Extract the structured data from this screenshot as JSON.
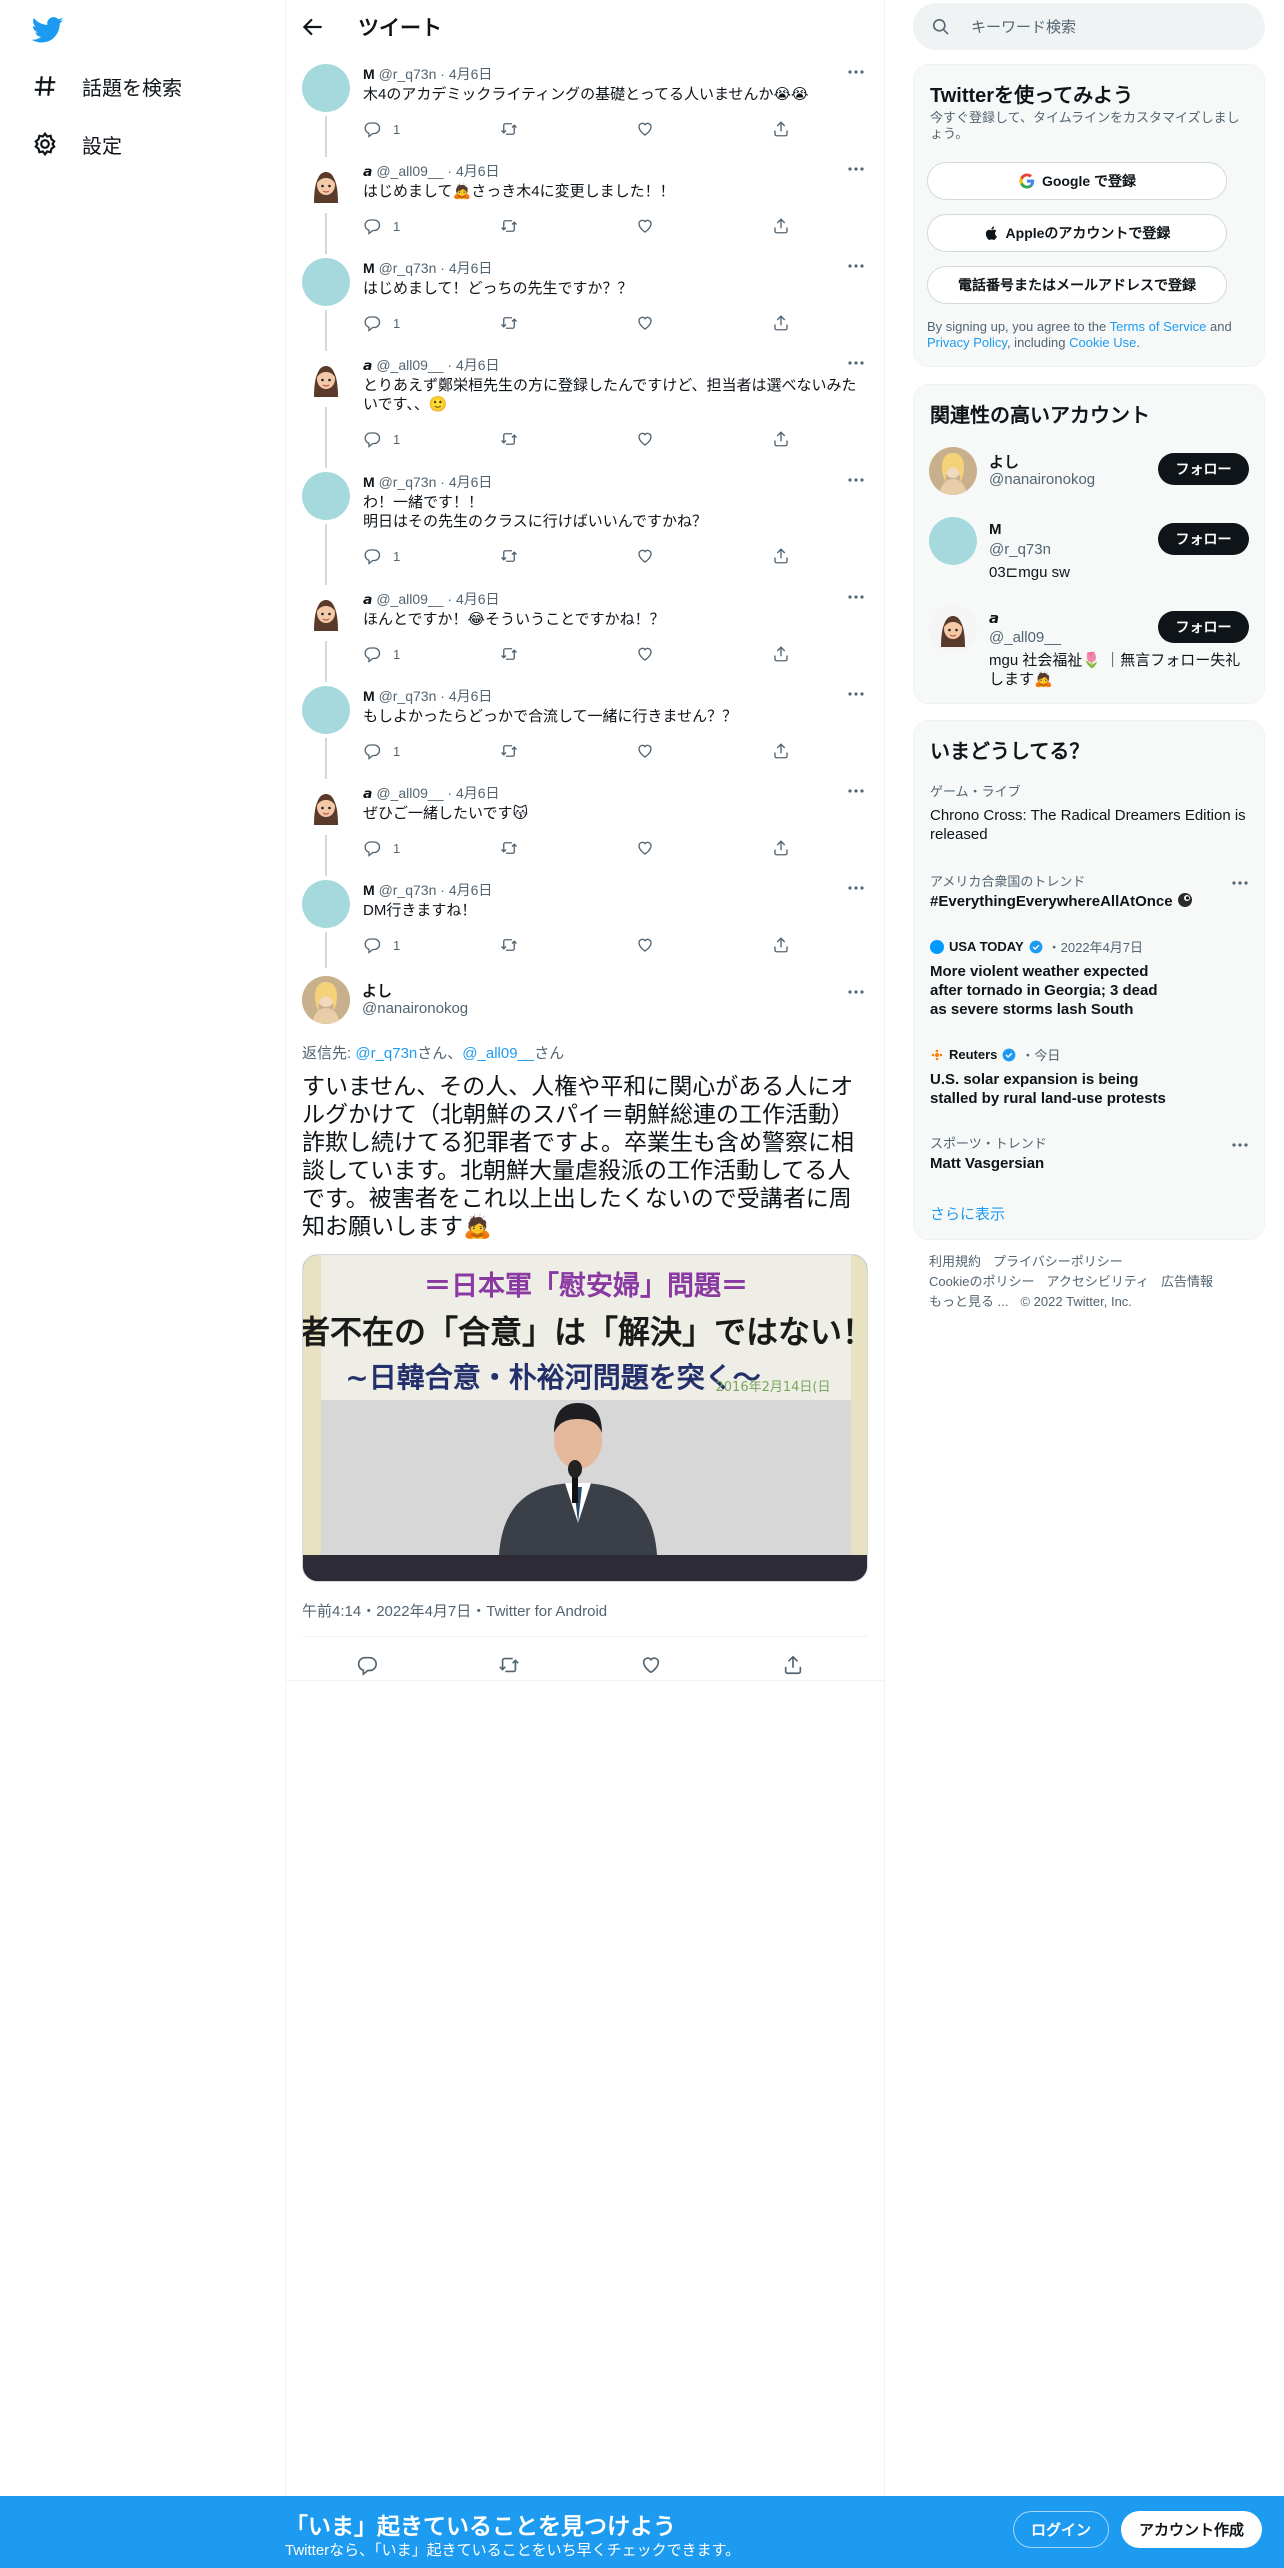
{
  "nav": {
    "search_topics": "話題を検索",
    "settings": "設定"
  },
  "header": {
    "title": "ツイート"
  },
  "replies": [
    {
      "author": "M",
      "handle": "@r_q73n",
      "date": "4月6日",
      "text": "木4のアカデミックライティングの基礎とってる人いませんか😭😭",
      "replies": "1",
      "avatar": "M"
    },
    {
      "author": "𝙖",
      "handle": "@_all09__",
      "date": "4月6日",
      "text": "はじめまして🙇さっき木4に変更しました！！",
      "replies": "1",
      "avatar": "a"
    },
    {
      "author": "M",
      "handle": "@r_q73n",
      "date": "4月6日",
      "text": "はじめまして！どっちの先生ですか？？",
      "replies": "1",
      "avatar": "M"
    },
    {
      "author": "𝙖",
      "handle": "@_all09__",
      "date": "4月6日",
      "text": "とりあえず鄭栄桓先生の方に登録したんですけど、担当者は選べないみたいです、、🙂",
      "replies": "1",
      "avatar": "a"
    },
    {
      "author": "M",
      "handle": "@r_q73n",
      "date": "4月6日",
      "text": "わ！一緒です！！\n明日はその先生のクラスに行けばいいんですかね？",
      "replies": "1",
      "avatar": "M"
    },
    {
      "author": "𝙖",
      "handle": "@_all09__",
      "date": "4月6日",
      "text": "ほんとですか！😂そういうことですかね！？",
      "replies": "1",
      "avatar": "a"
    },
    {
      "author": "M",
      "handle": "@r_q73n",
      "date": "4月6日",
      "text": "もしよかったらどっかで合流して一緒に行きません？？",
      "replies": "1",
      "avatar": "M"
    },
    {
      "author": "𝙖",
      "handle": "@_all09__",
      "date": "4月6日",
      "text": "ぜひご一緒したいです😽",
      "replies": "1",
      "avatar": "a"
    },
    {
      "author": "M",
      "handle": "@r_q73n",
      "date": "4月6日",
      "text": "DM行きますね！",
      "replies": "1",
      "avatar": "M"
    }
  ],
  "main_tweet": {
    "author": "よし",
    "handle": "@nanaironokog",
    "reply_prefix": "返信先: ",
    "reply_to_1": "@r_q73n",
    "reply_mid": "さん、",
    "reply_to_2": "@_all09__",
    "reply_suffix": "さん",
    "text": "すいません、その人、人権や平和に関心がある人にオルグかけて（北朝鮮のスパイ＝朝鮮総連の工作活動）詐欺し続けてる犯罪者ですよ。卒業生も含め警察に相談しています。北朝鮮大量虐殺派の工作活動してる人です。被害者をこれ以上出したくないので受講者に周知お願いします🙇",
    "media_banner_line1": "＝日本軍「慰安婦」問題＝",
    "media_banner_line2": "者不在の「合意」は「解決」ではない！",
    "media_banner_line3": "~日韓合意・朴裕河問題を突く～",
    "media_banner_date": "2016年2月14日(日",
    "meta": "午前4:14・2022年4月7日・Twitter for Android"
  },
  "search": {
    "placeholder": "キーワード検索"
  },
  "signup": {
    "title": "Twitterを使ってみよう",
    "subtitle": "今すぐ登録して、タイムラインをカスタマイズしましょう。",
    "google": "Google で登録",
    "apple": "Appleのアカウントで登録",
    "phone": "電話番号またはメールアドレスで登録",
    "legal_1": "By signing up, you agree to the ",
    "legal_tos": "Terms of Service",
    "legal_2": " and ",
    "legal_pp": "Privacy Policy",
    "legal_3": ", including ",
    "legal_cookie": "Cookie Use",
    "legal_4": "."
  },
  "relevant": {
    "title": "関連性の高いアカウント",
    "follow_label": "フォロー",
    "accounts": [
      {
        "name": "よし",
        "handle": "@nanaironokog",
        "bio": ""
      },
      {
        "name": "M",
        "handle": "@r_q73n",
        "bio": "03⊏mgu sw"
      },
      {
        "name": "𝙖",
        "handle": "@_all09__",
        "bio": "mgu 社会福祉🌷 ｜無言フォロー失礼します🙇"
      }
    ]
  },
  "trends": {
    "title": "いまどうしてる？",
    "items": [
      {
        "category": "ゲーム・ライブ",
        "headline": "Chrono Cross: The Radical Dreamers Edition is released"
      },
      {
        "category": "アメリカ合衆国のトレンド",
        "headline": "#EverythingEverywhereAllAtOnce"
      },
      {
        "source": "USA TODAY",
        "time": "・2022年4月7日",
        "headline": "More violent weather expected after tornado in Georgia; 3 dead as severe storms lash South"
      },
      {
        "source": "Reuters",
        "time": "・今日",
        "headline": "U.S. solar expansion is being stalled by rural land-use protests"
      },
      {
        "category": "スポーツ・トレンド",
        "headline": "Matt Vasgersian"
      }
    ],
    "show_more": "さらに表示"
  },
  "footer": {
    "terms": "利用規約",
    "privacy": "プライバシーポリシー",
    "cookie": "Cookieのポリシー",
    "accessibility": "アクセシビリティ",
    "ads": "広告情報",
    "more": "もっと見る ...",
    "copyright": "© 2022 Twitter, Inc."
  },
  "bottom_bar": {
    "title": "「いま」起きていることを見つけよう",
    "subtitle": "Twitterなら、「いま」起きていることをいち早くチェックできます。",
    "login": "ログイン",
    "signup": "アカウント作成"
  },
  "colors": {
    "accent": "#1d9bf0",
    "text": "#0f1419",
    "muted": "#536471",
    "avatar_m": "#a6d9dd"
  }
}
